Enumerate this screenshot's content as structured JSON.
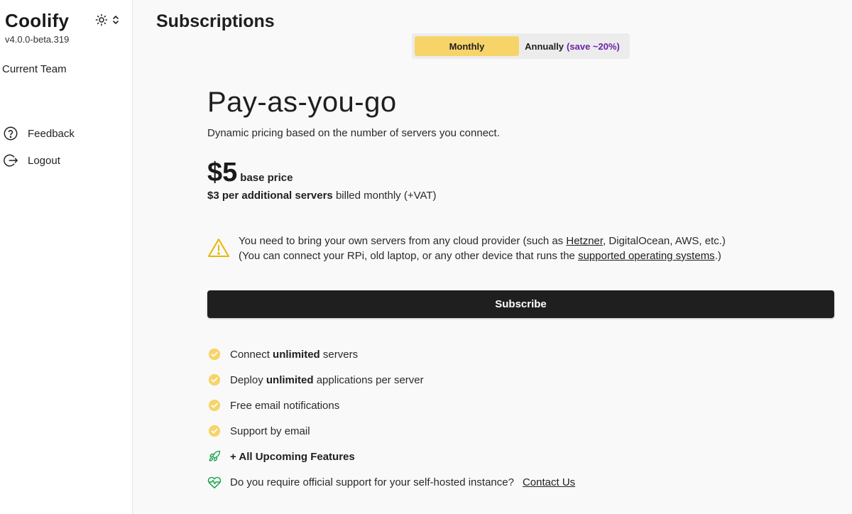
{
  "sidebar": {
    "brand": "Coolify",
    "version": "v4.0.0-beta.319",
    "theme_icon": "sun-icon",
    "team_label": "Current Team",
    "items": [
      {
        "label": "Feedback",
        "icon": "question-circle-icon"
      },
      {
        "label": "Logout",
        "icon": "logout-icon"
      }
    ]
  },
  "header": {
    "title": "Subscriptions"
  },
  "billing_toggle": {
    "monthly_label": "Monthly",
    "annually_label": "Annually",
    "annually_save": "(save ~20%)",
    "selected": "Monthly",
    "selected_color": "#f7d46a",
    "save_color": "#6b21a8"
  },
  "plan": {
    "title": "Pay-as-you-go",
    "description": "Dynamic pricing based on the number of servers you connect.",
    "base_price": "$5",
    "base_price_label": "base price",
    "additional_price": "$3",
    "additional_label": "per additional servers",
    "billing_note": "billed monthly (+VAT)"
  },
  "notice": {
    "icon": "warning-triangle-icon",
    "line1_prefix": "You need to bring your own servers from any cloud provider (such as",
    "line1_link": "Hetzner",
    "line1_suffix": ", DigitalOcean, AWS, etc.)",
    "line2_prefix": "(You can connect your RPi, old laptop, or any other device that runs the",
    "line2_link": "supported operating systems",
    "line2_suffix": ".)"
  },
  "subscribe_label": "Subscribe",
  "features": [
    {
      "icon": "check-circle-icon",
      "pre": "Connect",
      "bold": "unlimited",
      "post": "servers"
    },
    {
      "icon": "check-circle-icon",
      "pre": "Deploy",
      "bold": "unlimited",
      "post": "applications per server"
    },
    {
      "icon": "check-circle-icon",
      "pre": "Free email notifications",
      "bold": "",
      "post": ""
    },
    {
      "icon": "check-circle-icon",
      "pre": "Support by email",
      "bold": "",
      "post": ""
    },
    {
      "icon": "rocket-icon",
      "pre": "",
      "bold": "+ All Upcoming Features",
      "post": ""
    },
    {
      "icon": "heart-pulse-icon",
      "pre": "Do you require official support for your self-hosted instance?",
      "bold": "",
      "post": "",
      "link": "Contact Us"
    }
  ],
  "colors": {
    "accent": "#f7d46a",
    "dark": "#1f1f1f",
    "green": "#16a34a",
    "purple": "#6b21a8"
  }
}
